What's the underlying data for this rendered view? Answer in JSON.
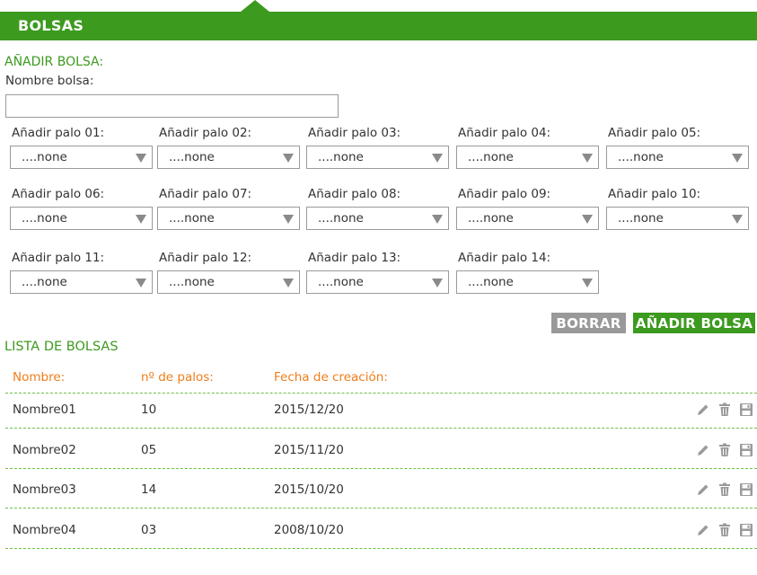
{
  "header": {
    "title": "BOLSAS"
  },
  "add_form": {
    "title": "AÑADIR BOLSA:",
    "name_label": "Nombre bolsa:",
    "name_value": "",
    "name_placeholder": "",
    "palos": [
      {
        "label": "Añadir palo 01:",
        "value": "....none"
      },
      {
        "label": "Añadir palo 02:",
        "value": "....none"
      },
      {
        "label": "Añadir palo 03:",
        "value": "....none"
      },
      {
        "label": "Añadir palo 04:",
        "value": "....none"
      },
      {
        "label": "Añadir palo 05:",
        "value": "....none"
      },
      {
        "label": "Añadir palo 06:",
        "value": "....none"
      },
      {
        "label": "Añadir palo 07:",
        "value": "....none"
      },
      {
        "label": "Añadir palo 08:",
        "value": "....none"
      },
      {
        "label": "Añadir palo 09:",
        "value": "....none"
      },
      {
        "label": "Añadir palo 10:",
        "value": "....none"
      },
      {
        "label": "Añadir palo 11:",
        "value": "....none"
      },
      {
        "label": "Añadir palo 12:",
        "value": "....none"
      },
      {
        "label": "Añadir palo 13:",
        "value": "....none"
      },
      {
        "label": "Añadir palo 14:",
        "value": "....none"
      }
    ],
    "borrar_label": "BORRAR",
    "add_label": "AÑADIR BOLSA"
  },
  "list": {
    "title": "LISTA DE BOLSAS",
    "columns": [
      "Nombre:",
      "nº de palos:",
      "Fecha de creación:"
    ],
    "rows": [
      {
        "name": "Nombre01",
        "palos": "10",
        "date": "2015/12/20"
      },
      {
        "name": "Nombre02",
        "palos": "05",
        "date": "2015/11/20"
      },
      {
        "name": "Nombre03",
        "palos": "14",
        "date": "2015/10/20"
      },
      {
        "name": "Nombre04",
        "palos": "03",
        "date": "2008/10/20"
      }
    ],
    "row_icons": [
      "pencil-icon",
      "trash-icon",
      "save-icon"
    ]
  },
  "colors": {
    "accent": "#3c9a1f",
    "header_text": "#f07d1a",
    "button_gray": "#999999"
  }
}
